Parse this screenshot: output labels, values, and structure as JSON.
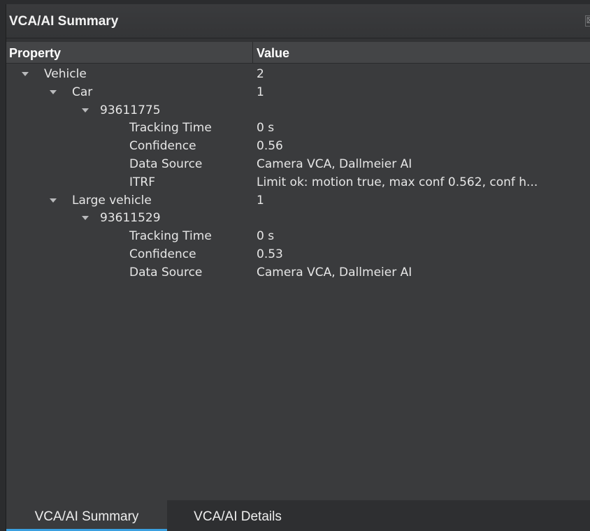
{
  "panel": {
    "title": "VCA/AI Summary",
    "close_glyph": "⊠"
  },
  "table": {
    "columns": [
      "Property",
      "Value"
    ],
    "rows": [
      {
        "level": 0,
        "expanded": true,
        "property": "Vehicle",
        "value": "2"
      },
      {
        "level": 1,
        "expanded": true,
        "property": "Car",
        "value": "1"
      },
      {
        "level": 2,
        "expanded": true,
        "property": "93611775",
        "value": ""
      },
      {
        "level": 3,
        "expanded": false,
        "property": "Tracking Time",
        "value": "0 s"
      },
      {
        "level": 3,
        "expanded": false,
        "property": "Confidence",
        "value": "0.56"
      },
      {
        "level": 3,
        "expanded": false,
        "property": "Data Source",
        "value": "Camera VCA, Dallmeier AI"
      },
      {
        "level": 3,
        "expanded": false,
        "property": "ITRF",
        "value": "Limit ok: motion true, max conf 0.562, conf h..."
      },
      {
        "level": 1,
        "expanded": true,
        "property": "Large vehicle",
        "value": "1"
      },
      {
        "level": 2,
        "expanded": true,
        "property": "93611529",
        "value": ""
      },
      {
        "level": 3,
        "expanded": false,
        "property": "Tracking Time",
        "value": "0 s"
      },
      {
        "level": 3,
        "expanded": false,
        "property": "Confidence",
        "value": "0.53"
      },
      {
        "level": 3,
        "expanded": false,
        "property": "Data Source",
        "value": "Camera VCA, Dallmeier AI"
      }
    ]
  },
  "tabs": [
    {
      "label": "VCA/AI Summary",
      "active": true
    },
    {
      "label": "VCA/AI Details",
      "active": false
    }
  ],
  "colors": {
    "accent": "#3aa0e0",
    "panel_bg": "#323335",
    "grid_bg": "#3a3b3d",
    "header_bg": "#444547"
  },
  "icons": [
    "expand-arrow-icon",
    "close-icon"
  ]
}
